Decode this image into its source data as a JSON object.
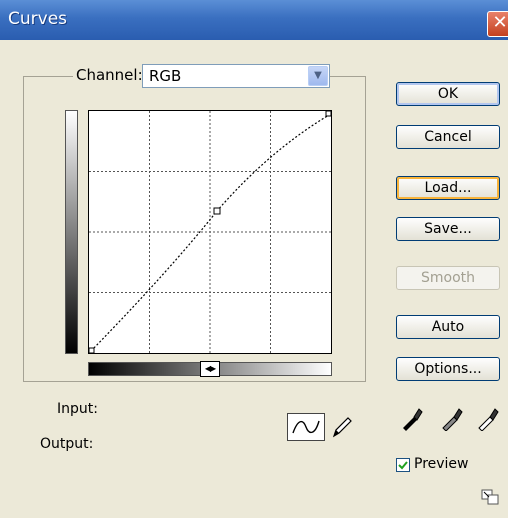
{
  "window": {
    "title": "Curves",
    "close_glyph": "✕"
  },
  "channel": {
    "label": "Channel:",
    "value": "RGB"
  },
  "labels": {
    "input": "Input:",
    "output": "Output:",
    "gradient_toggle": "◀▶"
  },
  "buttons": {
    "ok": "OK",
    "cancel": "Cancel",
    "load": "Load...",
    "save": "Save...",
    "smooth": "Smooth",
    "auto": "Auto",
    "options": "Options..."
  },
  "preview": {
    "label": "Preview",
    "checked": true,
    "check_glyph": "✓"
  },
  "tools": [
    "curve-icon",
    "pencil-icon",
    "black-eyedropper-icon",
    "gray-eyedropper-icon",
    "white-eyedropper-icon"
  ],
  "colors": {
    "title_bar": "#3a6fc0",
    "window_bg": "#ece9d8",
    "button_border": "#003c74",
    "focus_ring": "#f8b43b"
  }
}
